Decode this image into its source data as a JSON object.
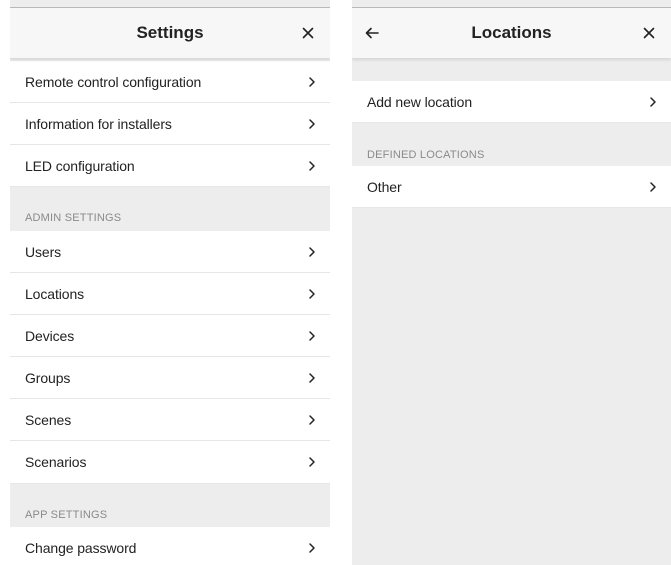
{
  "settings": {
    "title": "Settings",
    "close_icon": "close-icon",
    "items": [
      {
        "label": "Remote control configuration"
      },
      {
        "label": "Information for installers"
      },
      {
        "label": "LED configuration"
      }
    ],
    "admin_section": "ADMIN SETTINGS",
    "admin_items": [
      {
        "label": "Users"
      },
      {
        "label": "Locations"
      },
      {
        "label": "Devices"
      },
      {
        "label": "Groups"
      },
      {
        "label": "Scenes"
      },
      {
        "label": "Scenarios"
      }
    ],
    "app_section": "APP SETTINGS",
    "app_items": [
      {
        "label": "Change password"
      }
    ]
  },
  "locations": {
    "title": "Locations",
    "back_icon": "arrow-left-icon",
    "close_icon": "close-icon",
    "add_label": "Add new location",
    "defined_section": "DEFINED LOCATIONS",
    "defined_items": [
      {
        "label": "Other"
      }
    ]
  },
  "colors": {
    "background": "#ededed",
    "row": "#ffffff",
    "header": "#f7f7f7",
    "section_text": "#8a8a8a",
    "text": "#222222"
  }
}
